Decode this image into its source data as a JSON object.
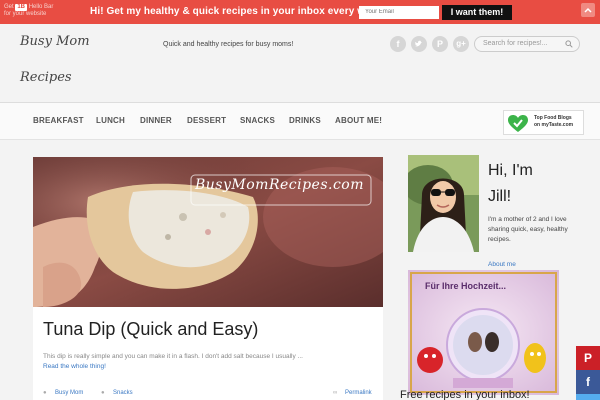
{
  "topbar": {
    "counter_pre": "Get",
    "counter_num": "1B",
    "counter_post": "Hello Bar",
    "counter_line2": "for your website",
    "promo_text": "Hi! Get my healthy & quick recipes in your inbox every week-",
    "email_placeholder": "Your Email",
    "submit_label": "I want them!",
    "bg_color": "#e84d43"
  },
  "header": {
    "logo_line1": "Busy Mom",
    "logo_line2": "Recipes",
    "tagline": "Quick and healthy recipes for busy moms!",
    "social_icons": [
      "facebook-icon",
      "twitter-icon",
      "pinterest-icon",
      "google-plus-icon"
    ],
    "search_placeholder": "Search for recipes!..."
  },
  "nav": {
    "items": [
      {
        "label": "BREAKFAST"
      },
      {
        "label": "LUNCH"
      },
      {
        "label": "DINNER"
      },
      {
        "label": "DESSERT"
      },
      {
        "label": "SNACKS"
      },
      {
        "label": "DRINKS"
      },
      {
        "label": "ABOUT ME!"
      }
    ],
    "badge_line1": "Top Food Blogs",
    "badge_line2": "on myTaste.com"
  },
  "post": {
    "image_watermark": "BusyMomRecipes.com",
    "title": "Tuna Dip (Quick and Easy)",
    "excerpt": "This dip is really simple and you can make it in a flash. I don't add salt because I usually ...",
    "read_more": "Read the whole thing!",
    "author": "Busy Mom",
    "category": "Snacks",
    "permalink": "Permalink"
  },
  "sidebar": {
    "greeting_line1": "Hi, I'm",
    "greeting_line2": "Jill!",
    "bio": "I'm a mother of 2 and I love sharing quick, easy, healthy recipes.",
    "about_link": "About me",
    "ad_title": "Für Ihre Hochzeit...",
    "newsletter_text": "Free recipes in your inbox!"
  },
  "share": {
    "pinterest": "P",
    "facebook": "f"
  }
}
